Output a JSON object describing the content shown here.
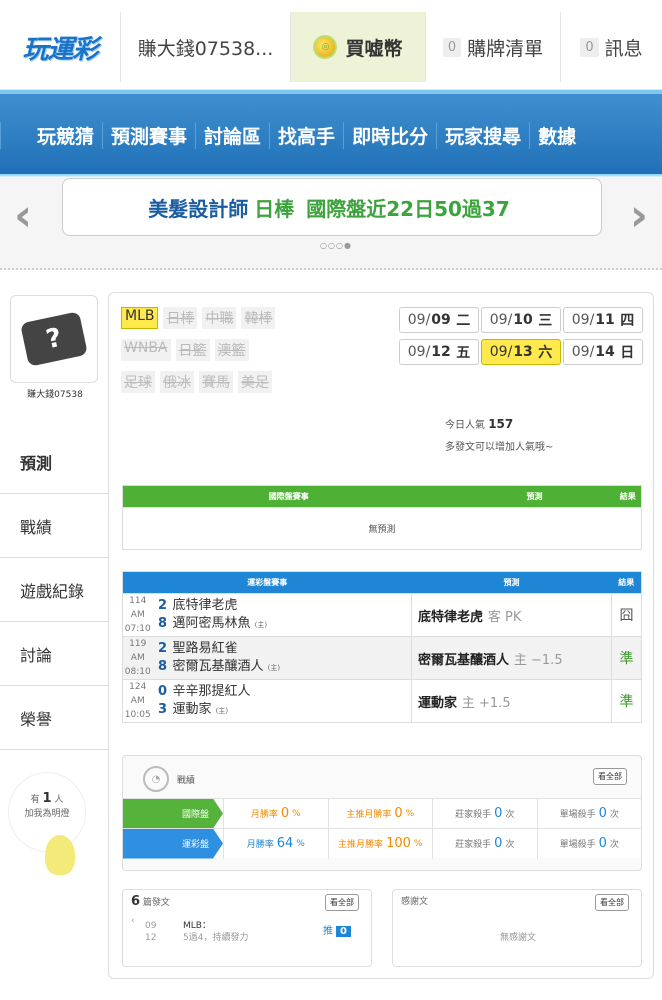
{
  "top": {
    "logo": "玩運彩",
    "user": "賺大錢07538...",
    "buy": "買嘘幣",
    "cart_count": "0",
    "cart": "購牌清單",
    "msg_count": "0",
    "msg": "訊息"
  },
  "nav": [
    "玩競猜",
    "預測賽事",
    "討論區",
    "找高手",
    "即時比分",
    "玩家搜尋",
    "數據"
  ],
  "banner": {
    "a": "美髮設計師",
    "b": "日棒",
    "c": "國際盤近22日50過37"
  },
  "user": {
    "name": "賺大錢07538"
  },
  "sidebar": [
    "預測",
    "戰績",
    "遊戲紀錄",
    "討論",
    "榮譽"
  ],
  "like": {
    "pre": "有",
    "count": "1",
    "post": "人",
    "sub": "加我為明燈"
  },
  "tags": [
    [
      "MLB",
      "日棒",
      "中職",
      "韓棒"
    ],
    [
      "WNBA",
      "日籃",
      "澳籃"
    ],
    [
      "足球",
      "俄冰",
      "賽馬",
      "美足"
    ]
  ],
  "dates": [
    {
      "d": "09/",
      "n": "09",
      "w": "二"
    },
    {
      "d": "09/",
      "n": "10",
      "w": "三"
    },
    {
      "d": "09/",
      "n": "11",
      "w": "四"
    },
    {
      "d": "09/",
      "n": "12",
      "w": "五"
    },
    {
      "d": "09/",
      "n": "13",
      "w": "六"
    },
    {
      "d": "09/",
      "n": "14",
      "w": "日"
    }
  ],
  "pop": {
    "label": "今日人氣",
    "value": "157",
    "sub": "多發文可以增加人氣哦~"
  },
  "intl": {
    "h1": "國際盤賽事",
    "h2": "預測",
    "h3": "結果",
    "empty": "無預測"
  },
  "sports": {
    "h1": "運彩盤賽事",
    "h2": "預測",
    "h3": "結果",
    "games": [
      {
        "no": "114",
        "time": "AM 07:10",
        "s1": "2",
        "t1": "底特律老虎",
        "s2": "8",
        "t2": "邁阿密馬林魚",
        "home": "(主)",
        "pick": "底特律老虎",
        "pd": "客 PK",
        "res": "囧"
      },
      {
        "no": "119",
        "time": "AM 08:10",
        "s1": "2",
        "t1": "聖路易紅雀",
        "s2": "8",
        "t2": "密爾瓦基釀酒人",
        "home": "(主)",
        "pick": "密爾瓦基釀酒人",
        "pd": "主 −1.5",
        "res": "準"
      },
      {
        "no": "124",
        "time": "AM 10:05",
        "s1": "0",
        "t1": "辛辛那提紅人",
        "s2": "3",
        "t2": "運動家",
        "home": "(主)",
        "pick": "運動家",
        "pd": "主 +1.5",
        "res": "準"
      }
    ]
  },
  "stats": {
    "title": "戰績",
    "all": "看全部",
    "rows": [
      {
        "label": "國際盤",
        "a": "月勝率",
        "av": "0",
        "au": "%",
        "b": "主推月勝率",
        "bv": "0",
        "bu": "%",
        "c": "莊家殺手",
        "cv": "0",
        "cu": "次",
        "d": "單場殺手",
        "dv": "0",
        "du": "次"
      },
      {
        "label": "運彩盤",
        "a": "月勝率",
        "av": "64",
        "au": "%",
        "b": "主推月勝率",
        "bv": "100",
        "bu": "%",
        "c": "莊家殺手",
        "cv": "0",
        "cu": "次",
        "d": "單場殺手",
        "dv": "0",
        "du": "次"
      }
    ]
  },
  "posts": {
    "count": "6",
    "label": "篇發文",
    "all": "看全部",
    "d1": "09",
    "d2": "12",
    "title": "MLB：",
    "desc": "5過4，持續發力",
    "push": "推",
    "pushn": "0"
  },
  "thanks": {
    "title": "感謝文",
    "all": "看全部",
    "empty": "無感謝文"
  }
}
